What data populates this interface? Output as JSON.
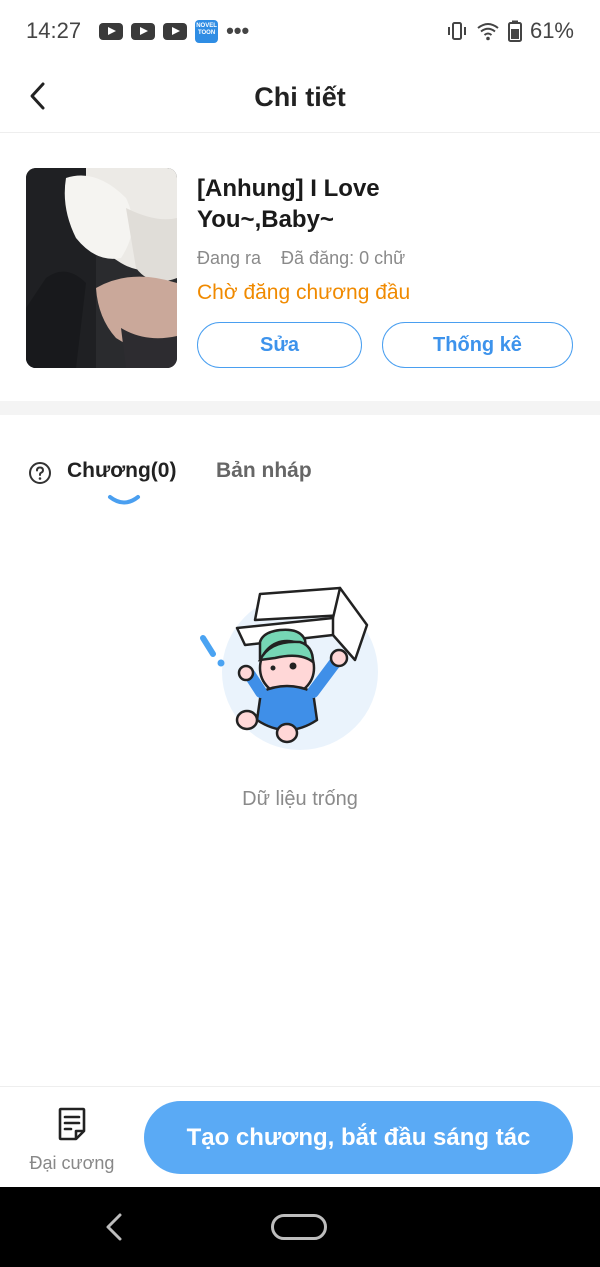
{
  "status_bar": {
    "time": "14:27",
    "app_icon_label": "NOVEL TOON",
    "more": "•••",
    "battery": "61%"
  },
  "header": {
    "title": "Chi tiết"
  },
  "book": {
    "title": "[Anhung] I Love You~,Baby~",
    "status": "Đang ra",
    "word_count": "Đã đăng: 0 chữ",
    "pending_notice": "Chờ đăng chương đầu",
    "edit_label": "Sửa",
    "stats_label": "Thống kê"
  },
  "tabs": {
    "chapters": "Chương(0)",
    "drafts": "Bản nháp"
  },
  "empty_state": {
    "message": "Dữ liệu trống"
  },
  "bottom_bar": {
    "outline_label": "Đại cương",
    "create_label": "Tạo chương, bắt đầu sáng tác"
  },
  "colors": {
    "accent": "#5aaaf5",
    "pending": "#f08a00"
  }
}
